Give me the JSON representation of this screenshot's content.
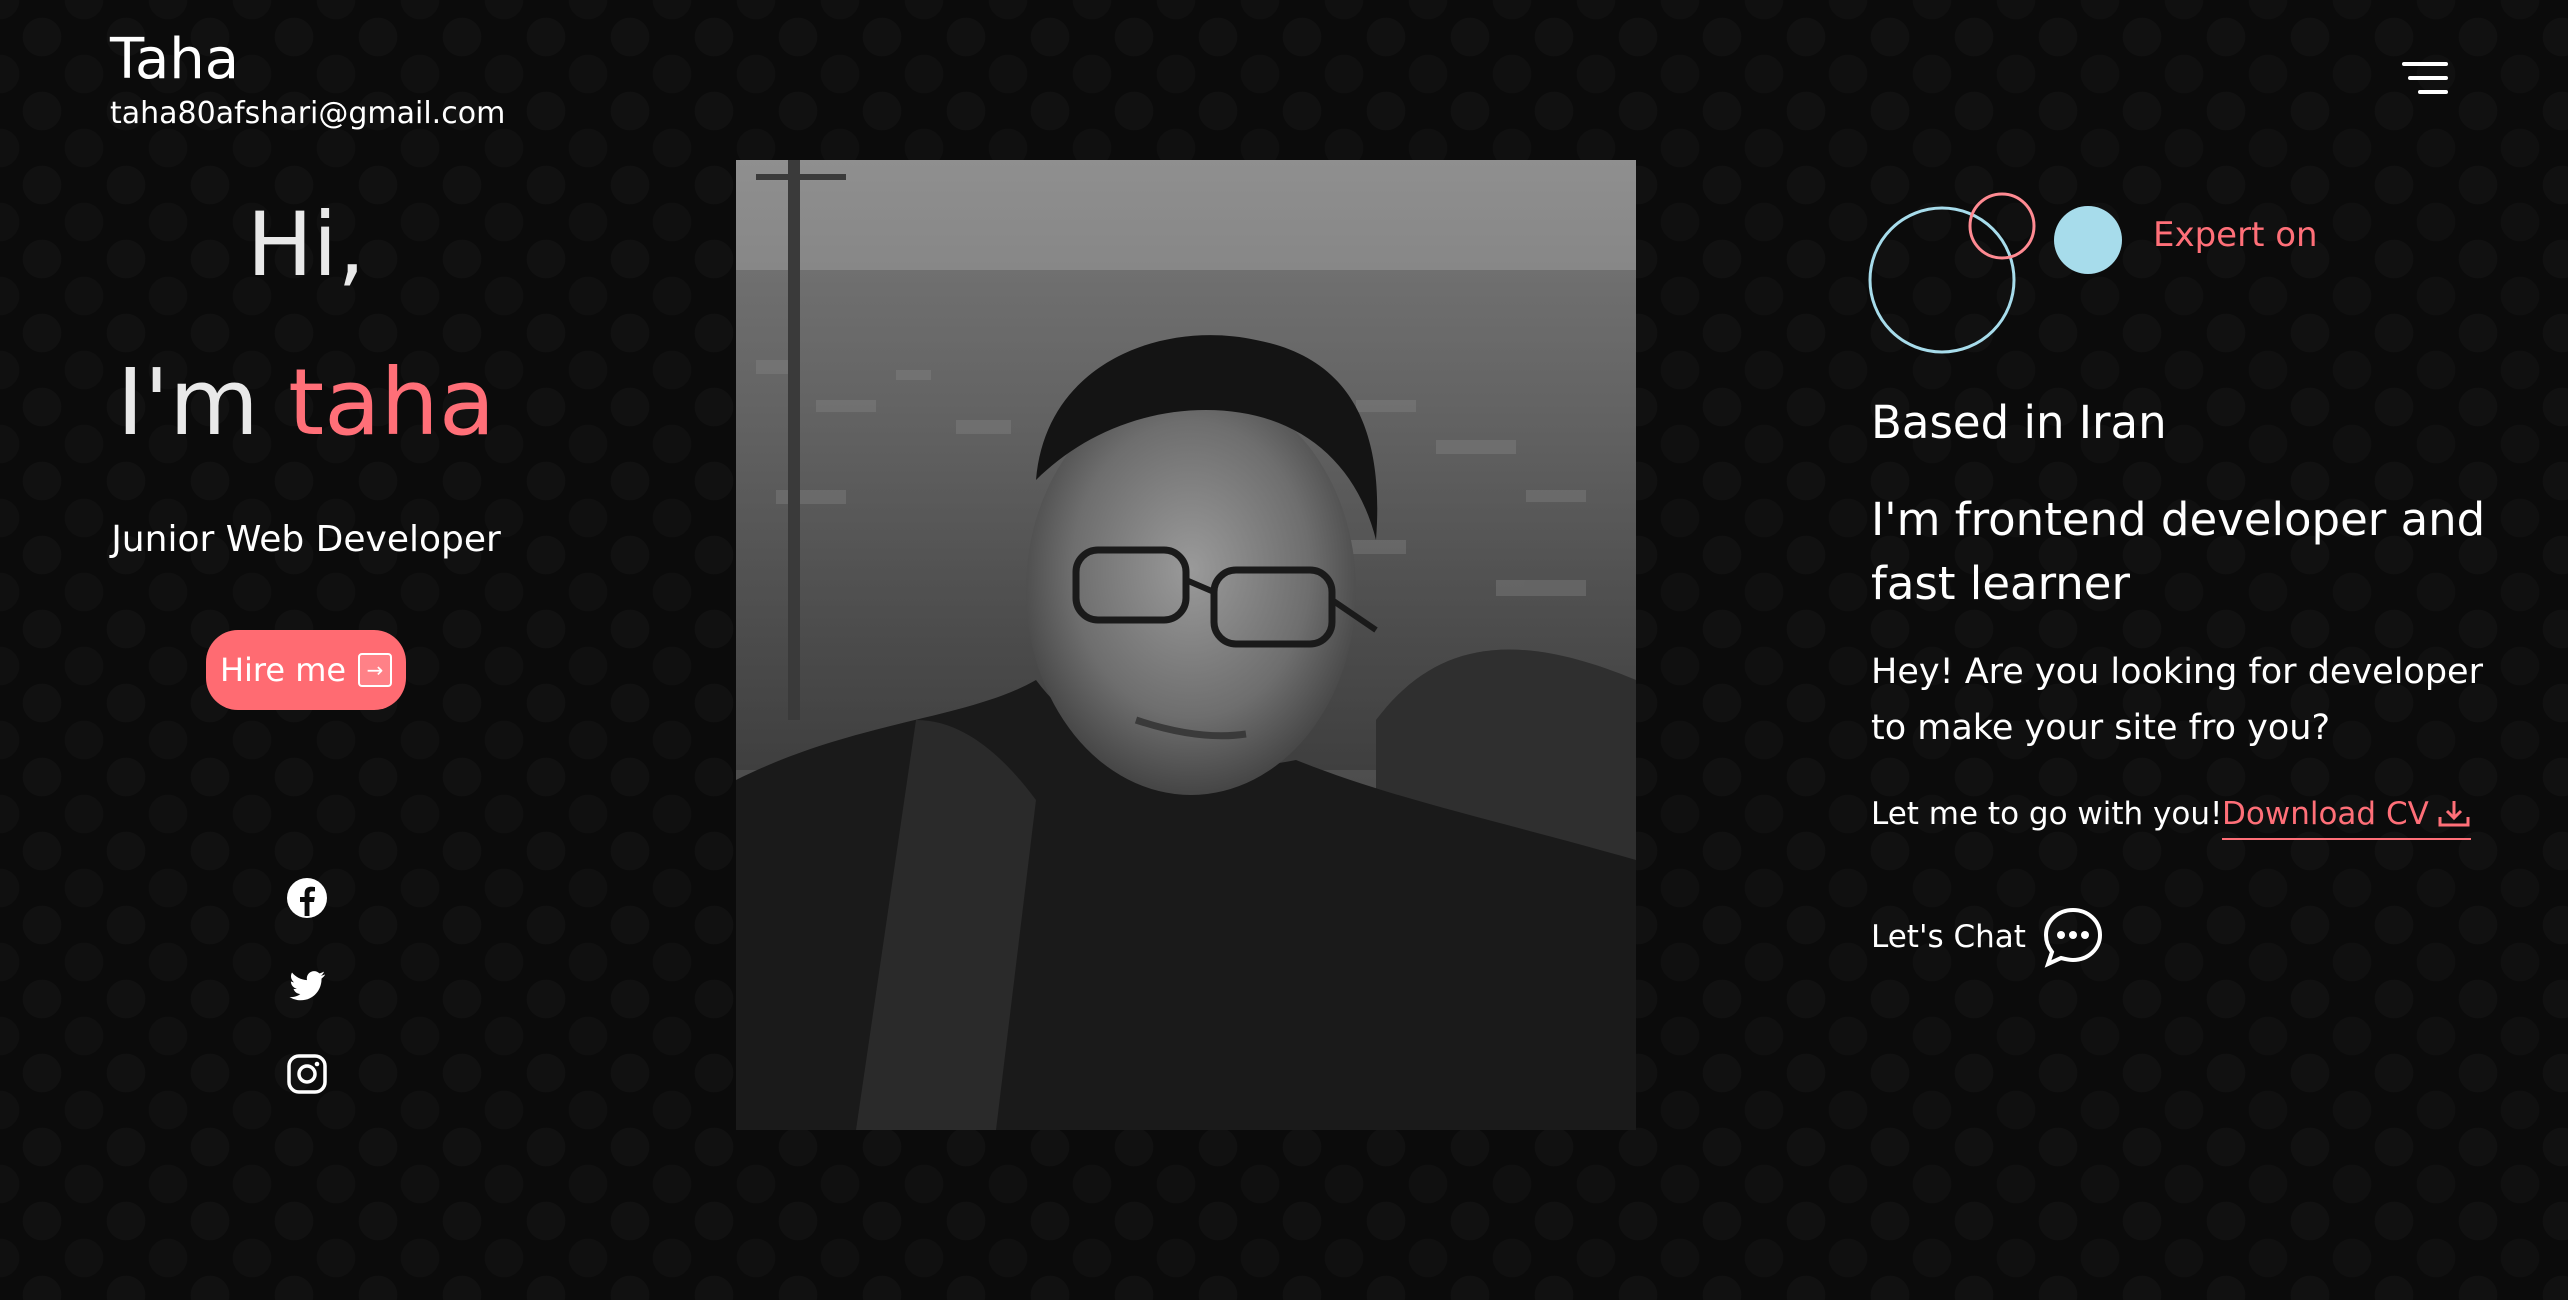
{
  "header": {
    "name": "Taha",
    "email": "taha80afshari@gmail.com",
    "menu_icon": "hamburger-menu-icon"
  },
  "hero": {
    "greeting": "Hi,",
    "intro_prefix": "I'm ",
    "intro_name": "taha",
    "role": "Junior Web Developer",
    "hire_label": "Hire me",
    "hire_icon": "arrow-right-box-icon"
  },
  "social": [
    {
      "name": "facebook-icon"
    },
    {
      "name": "twitter-icon"
    },
    {
      "name": "instagram-icon"
    }
  ],
  "about": {
    "expert_label": "Expert on",
    "location": "Based in Iran",
    "headline": "I'm frontend developer and fast learner",
    "description": "Hey! Are you looking for developer to make your site fro you?",
    "go_line": "Let me to go with you!",
    "download_label": "Download CV",
    "download_icon": "download-icon",
    "chat_label": "Let's Chat",
    "chat_icon": "chat-bubble-icon"
  },
  "colors": {
    "accent": "#ff6f78",
    "background": "#0b0b0b",
    "circle_blue": "#a7dceb",
    "text": "#ffffff"
  }
}
